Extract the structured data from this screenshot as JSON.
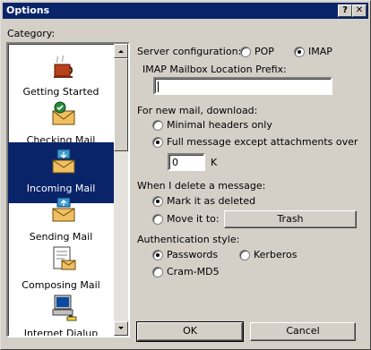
{
  "window": {
    "title": "Options",
    "help_glyph": "?",
    "close_glyph": "✕"
  },
  "category": {
    "label": "Category:",
    "items": [
      {
        "label": "Getting Started",
        "icon": "coffee-cup-icon"
      },
      {
        "label": "Checking Mail",
        "icon": "mail-check-icon"
      },
      {
        "label": "Incoming Mail",
        "icon": "incoming-mail-icon",
        "selected": true
      },
      {
        "label": "Sending Mail",
        "icon": "sending-mail-icon"
      },
      {
        "label": "Composing Mail",
        "icon": "composing-mail-icon"
      },
      {
        "label": "Internet Dialup",
        "icon": "dialup-computer-icon"
      }
    ]
  },
  "server": {
    "label": "Server configuration:",
    "pop": "POP",
    "imap": "IMAP",
    "selected": "IMAP"
  },
  "prefix": {
    "label": "IMAP Mailbox Location Prefix:",
    "value": ""
  },
  "download": {
    "label": "For new mail, download:",
    "minimal": "Minimal headers only",
    "full": "Full message except attachments over",
    "selected": "full",
    "size_value": "0",
    "unit": "K"
  },
  "delete": {
    "label": "When I delete a message:",
    "mark": "Mark it as deleted",
    "move": "Move it to:",
    "selected": "mark",
    "folder_button": "Trash"
  },
  "auth": {
    "label": "Authentication style:",
    "passwords": "Passwords",
    "kerberos": "Kerberos",
    "cram": "Cram-MD5",
    "selected": "passwords"
  },
  "buttons": {
    "ok": "OK",
    "cancel": "Cancel"
  },
  "colors": {
    "title_bar": "#0a246a",
    "face": "#d4d0c8",
    "selection": "#0a246a"
  }
}
